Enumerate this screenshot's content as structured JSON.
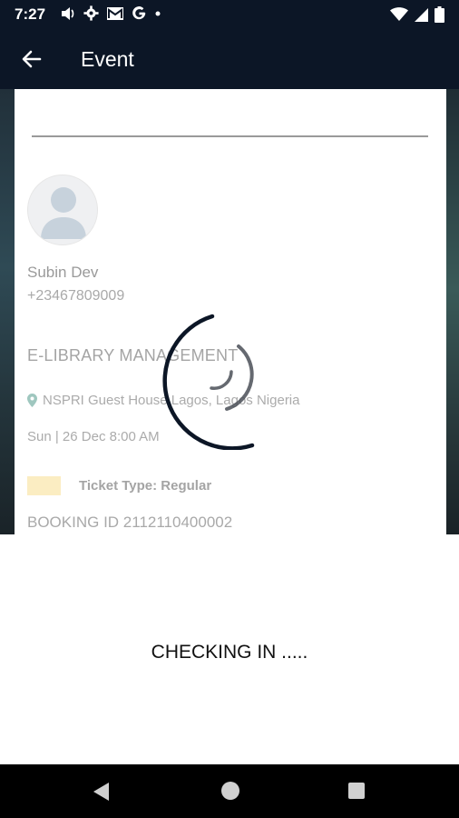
{
  "status_bar": {
    "time": "7:27",
    "icons_left": [
      "volume-icon",
      "gear-icon",
      "mail-icon",
      "google-icon",
      "dot-icon"
    ],
    "icons_right": [
      "wifi-icon",
      "signal-icon",
      "battery-icon"
    ]
  },
  "app_bar": {
    "title": "Event",
    "back_icon": "arrow-left-icon"
  },
  "ticket": {
    "user_name": "Subin Dev",
    "user_phone": "+23467809009",
    "event_title": "E-LIBRARY MANAGEMENT",
    "location": "NSPRI Guest House Lagos, Lagos Nigeria",
    "datetime": "Sun | 26 Dec 8:00 AM",
    "ticket_type": "Ticket Type: Regular",
    "ticket_type_color": "#fbedc2",
    "booking_id": "BOOKING ID 2112110400002"
  },
  "overlay": {
    "status_message": "CHECKING IN .....",
    "spinner_color": "#0c1626"
  },
  "nav_bar": {
    "buttons": [
      "back-icon",
      "home-icon",
      "recents-icon"
    ]
  },
  "colors": {
    "header_bg": "#0c1626",
    "muted_text": "#a9a9a9",
    "location_pin": "#9fc7bf"
  }
}
